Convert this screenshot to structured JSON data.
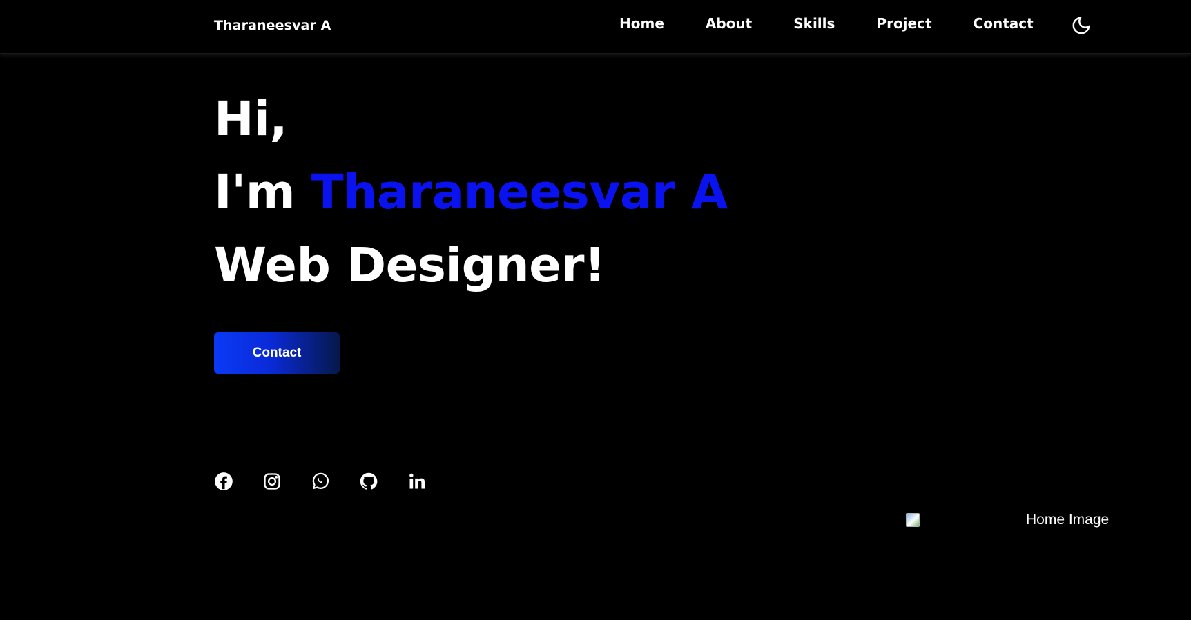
{
  "header": {
    "logo": "Tharaneesvar A",
    "nav": [
      {
        "label": "Home"
      },
      {
        "label": "About"
      },
      {
        "label": "Skills"
      },
      {
        "label": "Project"
      },
      {
        "label": "Contact"
      }
    ],
    "theme_toggle_icon": "moon-icon"
  },
  "hero": {
    "greeting": "Hi,",
    "intro_prefix": "I'm ",
    "name": "Tharaneesvar A",
    "role": "Web Designer!",
    "cta_label": "Contact"
  },
  "socials": [
    {
      "icon": "facebook-icon"
    },
    {
      "icon": "instagram-icon"
    },
    {
      "icon": "whatsapp-icon"
    },
    {
      "icon": "github-icon"
    },
    {
      "icon": "linkedin-icon"
    }
  ],
  "home_image": {
    "alt": "Home Image"
  },
  "colors": {
    "background": "#000000",
    "text": "#ffffff",
    "accent": "#0a12f0",
    "button_gradient_start": "#0a3af5",
    "button_gradient_end": "#06184a"
  }
}
